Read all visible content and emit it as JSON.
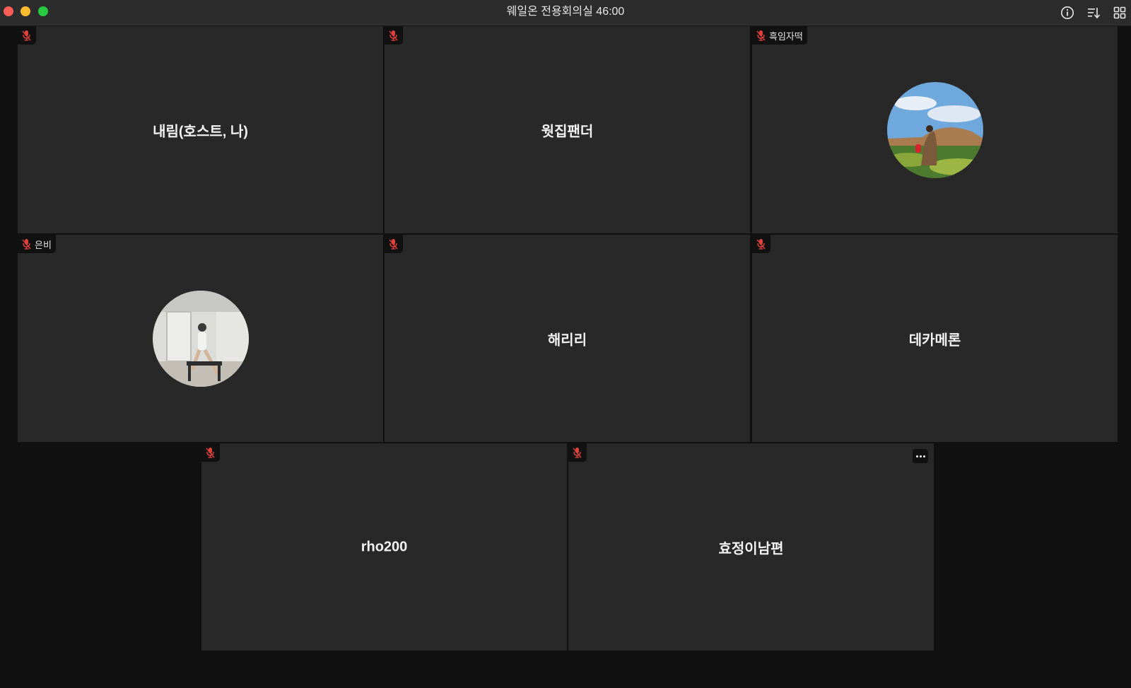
{
  "window": {
    "title": "웨일온 전용회의실 46:00"
  },
  "titlebar_icons": [
    "info-icon",
    "sort-list-icon",
    "grid-layout-icon"
  ],
  "participants": [
    {
      "name": "내림(호스트, 나)",
      "badge_name": "",
      "muted": true,
      "avatar": ""
    },
    {
      "name": "웟집팬더",
      "badge_name": "",
      "muted": true,
      "avatar": ""
    },
    {
      "name": "",
      "badge_name": "흑임자떡",
      "muted": true,
      "avatar": "landscape-photo-avatar"
    },
    {
      "name": "",
      "badge_name": "은비",
      "muted": true,
      "avatar": "indoor-photo-avatar"
    },
    {
      "name": "해리리",
      "badge_name": "",
      "muted": true,
      "avatar": ""
    },
    {
      "name": "데카메론",
      "badge_name": "",
      "muted": true,
      "avatar": ""
    },
    {
      "name": "rho200",
      "badge_name": "",
      "muted": true,
      "avatar": ""
    },
    {
      "name": "효정이남편",
      "badge_name": "",
      "muted": true,
      "avatar": ""
    }
  ],
  "colors": {
    "background": "#111111",
    "tile": "#282828",
    "titlebar": "#2c2c2c",
    "muted_mic": "#e0413a"
  }
}
